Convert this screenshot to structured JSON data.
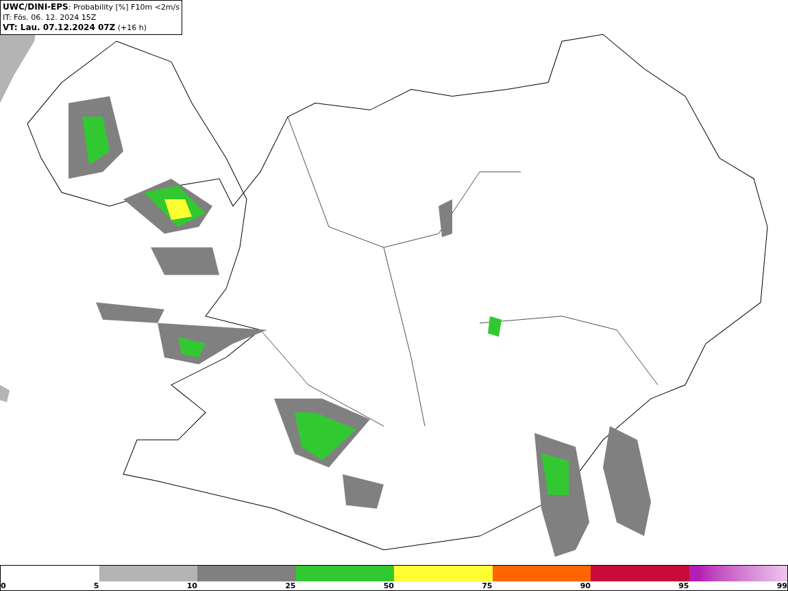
{
  "header": {
    "lines": [
      "**UWC/DINI-EPS**: Probability [%] F10m <2m/s",
      "IT: Fös. 06. 12. 2024 15Z",
      "**VT: Lau. 07.12.2024 07Z** (+16 h)"
    ]
  },
  "legend": {
    "segments": [
      {
        "color": "#ffffff"
      },
      {
        "color": "#b4b4b4"
      },
      {
        "color": "#808080"
      },
      {
        "color": "#32c832"
      },
      {
        "color": "#ffff32"
      },
      {
        "color": "#ff6400"
      },
      {
        "color": "#c80a3c"
      },
      {
        "color": "#b41eb4",
        "kind": "gradient"
      }
    ],
    "ticks": [
      "0",
      "5",
      "10",
      "25",
      "50",
      "75",
      "90",
      "95",
      "99"
    ]
  }
}
